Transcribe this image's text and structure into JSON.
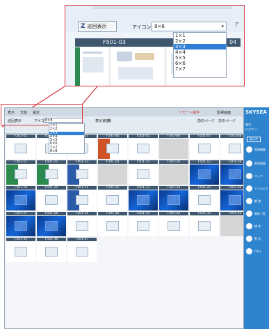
{
  "callout": {
    "button_label": "巡回表示",
    "button_icon": "Z",
    "icon_label": "アイコン:",
    "select_value": "8×8",
    "tail_text": "ア",
    "header_cells": [
      "F501-03",
      "F",
      "04"
    ],
    "options": [
      "1×1",
      "2×2",
      "3×3",
      "4×4",
      "5×5",
      "6×6",
      "7×7"
    ],
    "selected_option": "3×3"
  },
  "window": {
    "title_items": [
      "表示",
      "分割",
      "設定"
    ],
    "title_right": "リモート操作",
    "title_right2": "監視画面",
    "toolbar": {
      "patrol_button": "巡回表示",
      "icon_label": "アイコン:",
      "select_value": "8×8",
      "display_label": "表示速度:",
      "display_value": "標",
      "prev_page": "前のページ",
      "next_page": "次のページ",
      "options": [
        "1×1",
        "2×2",
        "3×3",
        "4×4",
        "5×5",
        "6×6",
        "7×7",
        "8×8"
      ],
      "selected_option": "3×3"
    },
    "cells": [
      {
        "label": "F501-01",
        "kind": "doc"
      },
      {
        "label": "F501-02",
        "kind": "doc"
      },
      {
        "label": "F501-03",
        "kind": "doc"
      },
      {
        "label": "F501-04",
        "kind": "red"
      },
      {
        "label": "F501-05",
        "kind": "doc"
      },
      {
        "label": "F501-06",
        "kind": "gray"
      },
      {
        "label": "F501-07",
        "kind": "doc"
      },
      {
        "label": "F501-08",
        "kind": "doc"
      },
      {
        "label": "F501-11",
        "kind": "green"
      },
      {
        "label": "F501-12",
        "kind": "green"
      },
      {
        "label": "F501-13",
        "kind": "blue"
      },
      {
        "label": "F501-14",
        "kind": "gray"
      },
      {
        "label": "F501-15",
        "kind": "doc"
      },
      {
        "label": "F501-16",
        "kind": "gray"
      },
      {
        "label": "F501-17",
        "kind": "win10"
      },
      {
        "label": "F501-18",
        "kind": "win10"
      },
      {
        "label": "F501-19",
        "kind": "win10"
      },
      {
        "label": "F501-20",
        "kind": "doc"
      },
      {
        "label": "F501-21",
        "kind": "blue"
      },
      {
        "label": "F501-22",
        "kind": "doc"
      },
      {
        "label": "F501-23",
        "kind": "win10"
      },
      {
        "label": "F501-24",
        "kind": "win10"
      },
      {
        "label": "F501-25",
        "kind": "doc"
      },
      {
        "label": "F501-26",
        "kind": "win10"
      },
      {
        "label": "F501-27",
        "kind": "win10"
      },
      {
        "label": "F501-28",
        "kind": "win10"
      },
      {
        "label": "F501-29",
        "kind": "doc"
      },
      {
        "label": "F501-30",
        "kind": "doc"
      },
      {
        "label": "F501-31",
        "kind": "doc"
      },
      {
        "label": "F501-32",
        "kind": "doc"
      },
      {
        "label": "F501-33",
        "kind": "doc"
      },
      {
        "label": "F501-34",
        "kind": "gray"
      },
      {
        "label": "F501-35",
        "kind": "doc"
      },
      {
        "label": "F501-36",
        "kind": "doc"
      },
      {
        "label": "F501-37",
        "kind": "doc"
      }
    ]
  },
  "right_panel": {
    "brand": "SKYSEA",
    "lines": [
      "端末:",
      "ログオン:"
    ],
    "button": "表示中",
    "items": [
      "電源制御",
      "利用制限",
      "ロック",
      "アンロック",
      "解 除",
      "資産一覧",
      "操 作",
      "警 告",
      "CALL"
    ]
  },
  "colors": {
    "header_bar": "#3e566e",
    "accent_red": "#d9333a",
    "panel_blue": "#2f84cf",
    "select_highlight": "#2f7fd6"
  }
}
